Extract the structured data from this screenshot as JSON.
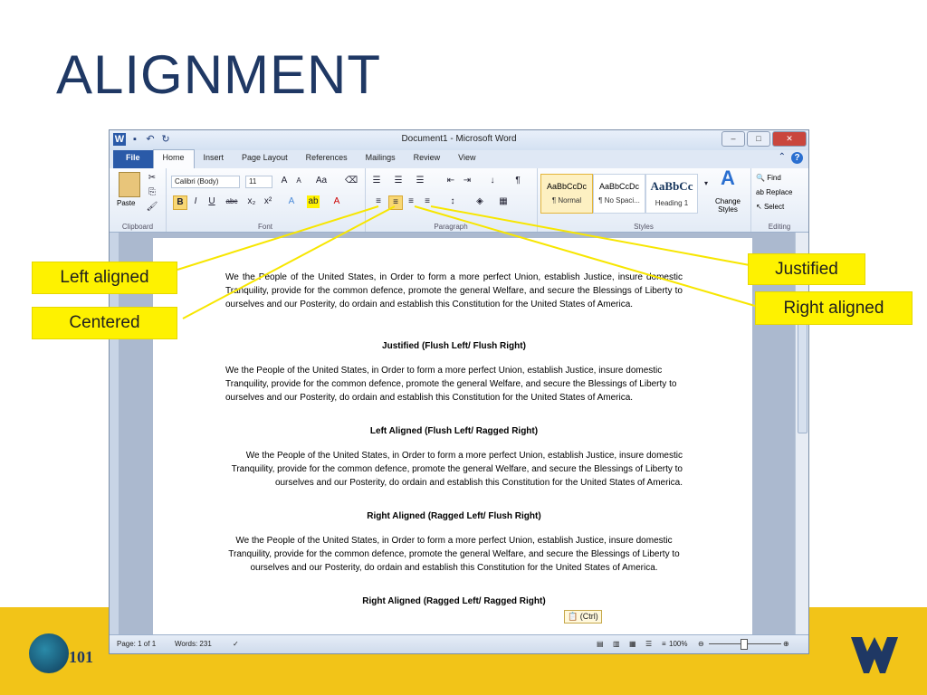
{
  "slide": {
    "title": "ALIGNMENT"
  },
  "window": {
    "title": "Document1  -  Microsoft Word",
    "tabs": [
      "File",
      "Home",
      "Insert",
      "Page Layout",
      "References",
      "Mailings",
      "Review",
      "View"
    ],
    "active_tab": "Home"
  },
  "ribbon": {
    "clipboard": {
      "paste": "Paste",
      "label": "Clipboard"
    },
    "font": {
      "name": "Calibri (Body)",
      "size": "11",
      "label": "Font"
    },
    "paragraph": {
      "label": "Paragraph"
    },
    "styles": {
      "label": "Styles",
      "items": [
        {
          "sample": "AaBbCcDc",
          "name": "¶ Normal"
        },
        {
          "sample": "AaBbCcDc",
          "name": "¶ No Spaci..."
        },
        {
          "sample": "AaBbCс",
          "name": "Heading 1"
        }
      ],
      "change_styles": "Change Styles"
    },
    "editing": {
      "find": "Find",
      "replace": "Replace",
      "select": "Select",
      "label": "Editing"
    }
  },
  "document": {
    "paragraphs": [
      {
        "text": "We the People  of the United States, in Order to form a more perfect Union, establish Justice, insure domestic Tranquility, provide for the common defence, promote the general Welfare, and secure the Blessings of Liberty to ourselves and our Posterity, do ordain and establish this Constitution for the United States of America.",
        "caption": "Justified (Flush Left/ Flush Right)"
      },
      {
        "text": "We the People  of the United States, in Order to form a more perfect Union, establish Justice, insure domestic Tranquility, provide for the common defence, promote the general Welfare, and secure the Blessings of Liberty to ourselves and our Posterity, do ordain and establish this Constitution for the United States of America.",
        "caption": "Left Aligned (Flush Left/ Ragged Right)"
      },
      {
        "text": "We the People  of the United States, in Order to form a more perfect Union, establish Justice, insure domestic Tranquility, provide for the common defence, promote the general Welfare, and secure the Blessings of Liberty to ourselves and our Posterity, do ordain and establish this Constitution for the United States of America.",
        "caption": "Right Aligned (Ragged Left/ Flush Right)"
      },
      {
        "text": "We the People  of the United States, in Order to form a more perfect Union, establish Justice, insure domestic Tranquility, provide for the common defence, promote the general Welfare, and secure the Blessings of Liberty to ourselves and our Posterity, do ordain and establish this Constitution for the United States of America.",
        "caption": "Right Aligned (Ragged Left/ Ragged Right)"
      }
    ],
    "ctrl_tag": "(Ctrl)"
  },
  "status": {
    "page": "Page: 1 of 1",
    "words": "Words: 231",
    "zoom": "100%"
  },
  "callouts": {
    "left": "Left aligned",
    "centered": "Centered",
    "justified": "Justified",
    "right": "Right aligned"
  },
  "logo": {
    "course": "101"
  },
  "colors": {
    "title": "#1f3864",
    "band": "#f2c418",
    "callout": "#fef200",
    "line": "#f7e600"
  }
}
